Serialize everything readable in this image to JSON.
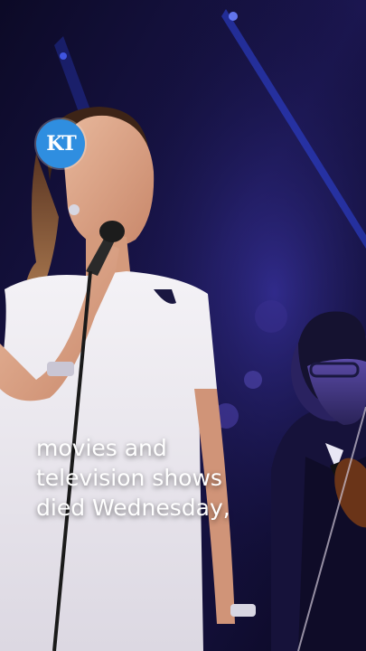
{
  "logo": {
    "text": "KT",
    "color": "#2f8ee0"
  },
  "caption": {
    "lines": [
      "movies and",
      "television shows",
      "died Wednesday,"
    ]
  }
}
